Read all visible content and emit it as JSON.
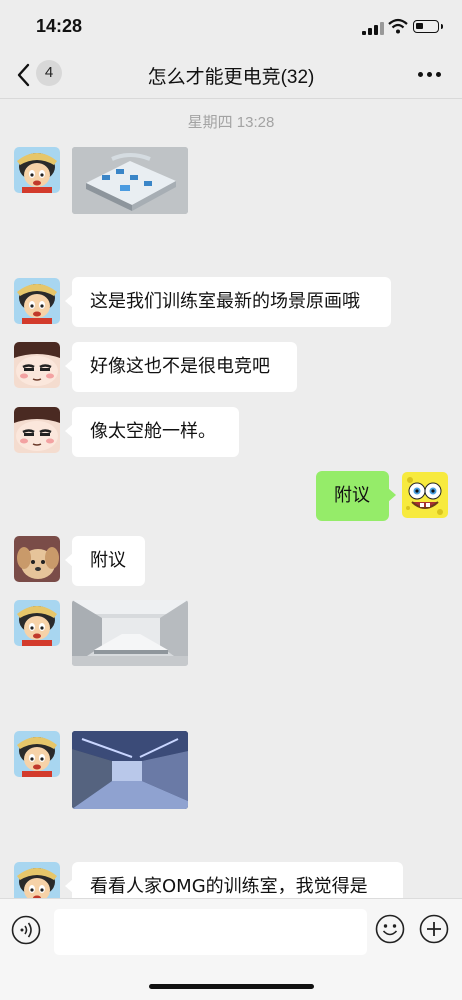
{
  "status_bar": {
    "time": "14:28",
    "battery_level": 0.35
  },
  "nav": {
    "unread_badge": "4",
    "title": "怎么才能更电竞(32)"
  },
  "timestamp": "星期四 13:28",
  "messages": [
    {
      "type": "image",
      "direction": "in",
      "sender_avatar": "luffy-avatar",
      "image": "training-room-concept-art"
    },
    {
      "type": "text",
      "direction": "in",
      "sender_avatar": "luffy-avatar",
      "text": "这是我们训练室最新的场景原画哦"
    },
    {
      "type": "text",
      "direction": "in",
      "sender_avatar": "cartoon-face-avatar",
      "text": "好像这也不是很电竞吧"
    },
    {
      "type": "text",
      "direction": "in",
      "sender_avatar": "cartoon-face-avatar",
      "text": "像太空舱一样。"
    },
    {
      "type": "text",
      "direction": "out",
      "sender_avatar": "spongebob-avatar",
      "text": "附议"
    },
    {
      "type": "text",
      "direction": "in",
      "sender_avatar": "puppy-avatar",
      "text": "附议"
    },
    {
      "type": "image",
      "direction": "in",
      "sender_avatar": "luffy-avatar",
      "image": "white-meeting-room-photo"
    },
    {
      "type": "image",
      "direction": "in",
      "sender_avatar": "luffy-avatar",
      "image": "blue-corridor-photo"
    },
    {
      "type": "text",
      "direction": "in",
      "sender_avatar": "luffy-avatar",
      "text": "看看人家OMG的训练室，我觉得是"
    }
  ],
  "input_bar": {
    "placeholder": ""
  },
  "colors": {
    "background": "#ededed",
    "outgoing_bubble": "#95ec69",
    "incoming_bubble": "#ffffff",
    "timestamp": "#a3a3a3"
  }
}
